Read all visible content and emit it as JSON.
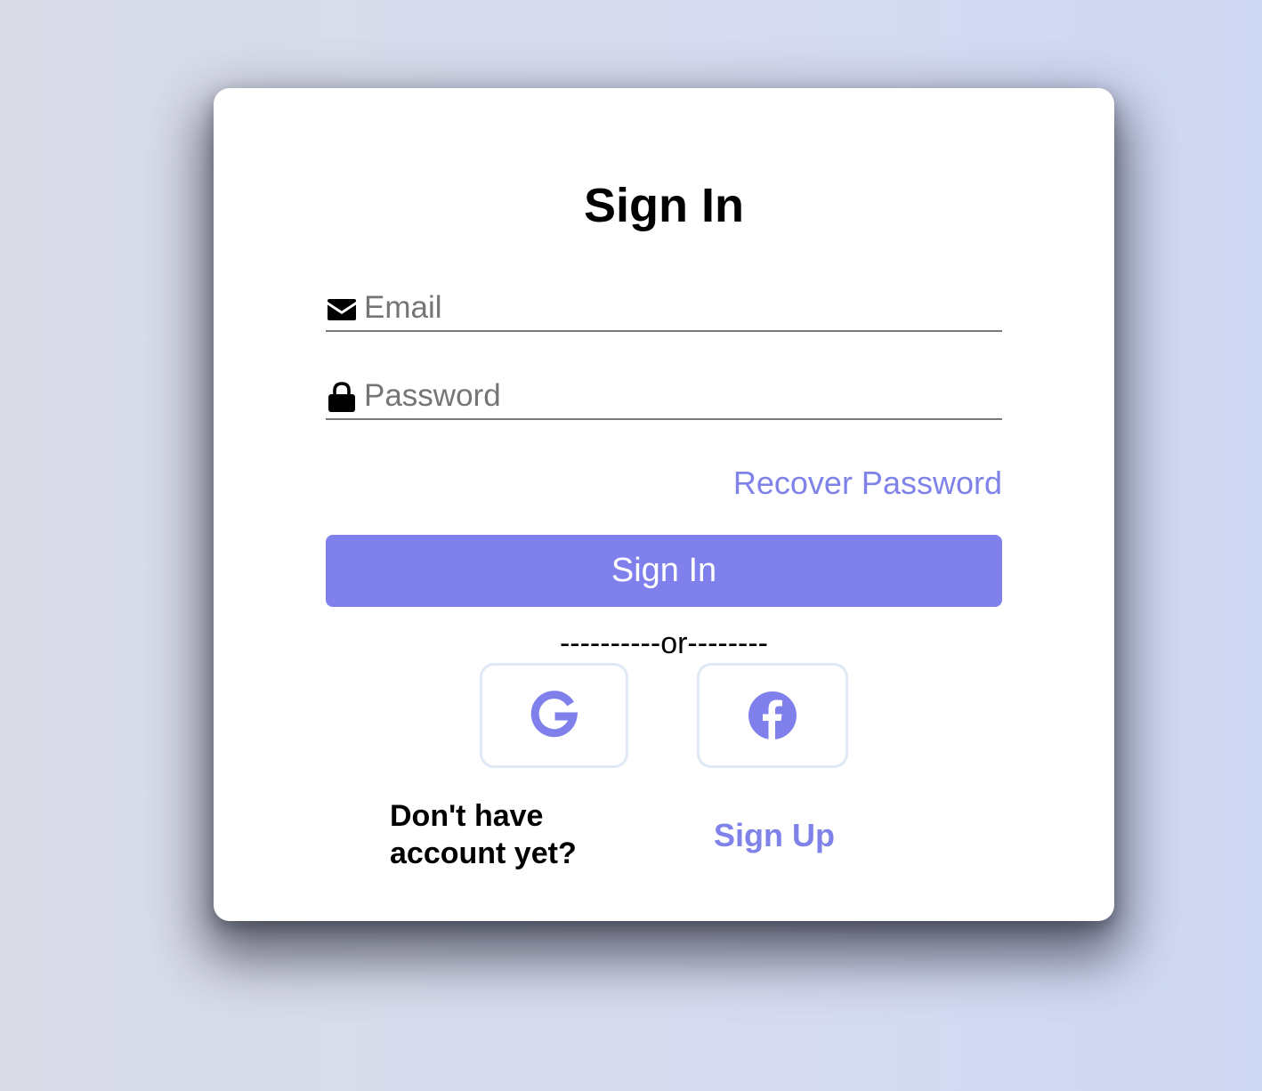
{
  "login": {
    "title": "Sign In",
    "email": {
      "placeholder": "Email",
      "value": "",
      "icon": "envelope-icon"
    },
    "password": {
      "placeholder": "Password",
      "value": "",
      "icon": "lock-icon"
    },
    "recover_label": "Recover Password",
    "submit_label": "Sign In",
    "divider_text": "----------or--------",
    "social": [
      {
        "icon": "google-icon"
      },
      {
        "icon": "facebook-icon"
      }
    ],
    "no_account_text": "Don't have account yet?",
    "signup_label": "Sign Up"
  },
  "colors": {
    "accent": "#7f80eb",
    "link": "#7f82e9",
    "card": "#ffffff",
    "social_border": "#dfe8f5",
    "background": "#d6dbef"
  }
}
